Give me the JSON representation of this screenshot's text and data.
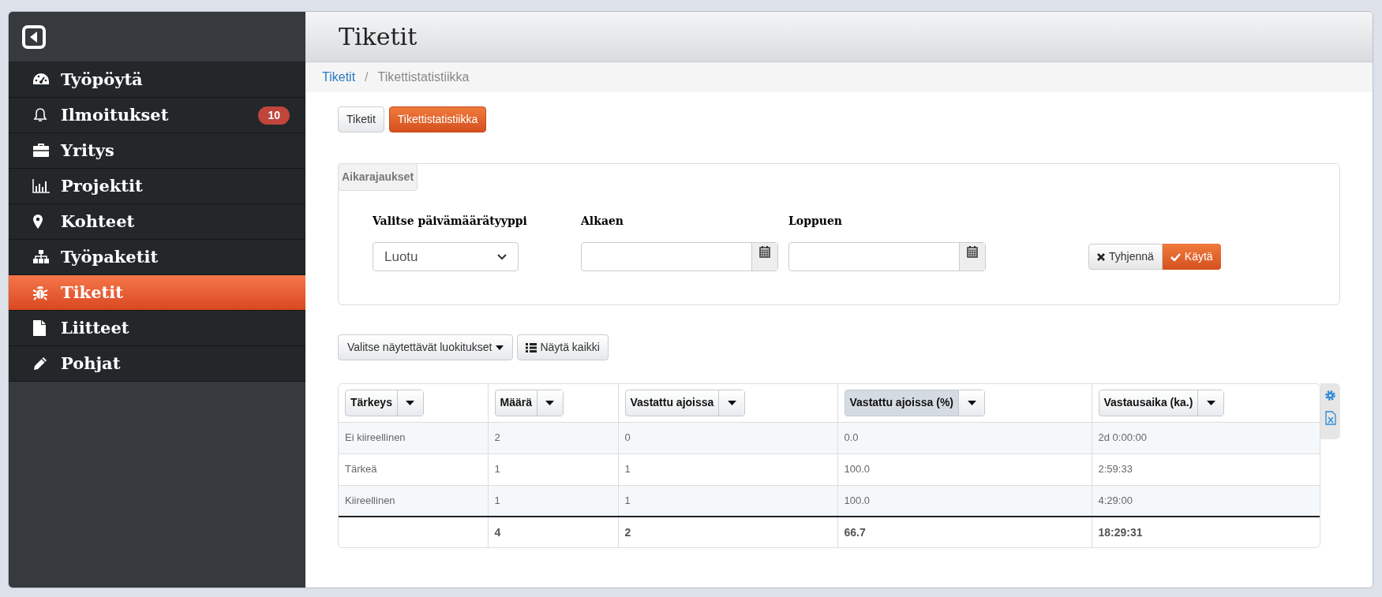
{
  "sidebar": {
    "items": [
      {
        "kind": "dashboard",
        "label": "Työpöytä",
        "selected": false
      },
      {
        "kind": "bell",
        "label": "Ilmoitukset",
        "selected": false,
        "badge": "10"
      },
      {
        "kind": "briefcase",
        "label": "Yritys",
        "selected": false
      },
      {
        "kind": "chart",
        "label": "Projektit",
        "selected": false
      },
      {
        "kind": "pin",
        "label": "Kohteet",
        "selected": false
      },
      {
        "kind": "sitemap",
        "label": "Työpaketit",
        "selected": false
      },
      {
        "kind": "bug",
        "label": "Tiketit",
        "selected": true
      },
      {
        "kind": "file",
        "label": "Liitteet",
        "selected": false
      },
      {
        "kind": "pencil",
        "label": "Pohjat",
        "selected": false
      }
    ]
  },
  "header": {
    "title": "Tiketit"
  },
  "breadcrumb": [
    {
      "label": "Tiketit",
      "link": true
    },
    {
      "separator": "/",
      "label": "Tikettistatistiikka",
      "link": false
    }
  ],
  "tabs": [
    {
      "label": "Tiketit",
      "selected": false
    },
    {
      "label": "Tikettistatistiikka",
      "selected": true
    }
  ],
  "filter": {
    "legend": "Aikarajaukset",
    "date_type": {
      "label": "Valitse päivämäärätyyppi",
      "value": "Luotu"
    },
    "start": {
      "label": "Alkaen"
    },
    "end": {
      "label": "Loppuen"
    },
    "clear": "Tyhjennä",
    "apply": "Käytä"
  },
  "toolbar": {
    "categories": "Valitse näytettävät luokitukset",
    "show_all": "Näytä kaikki"
  },
  "table": {
    "columns": [
      {
        "label": "Tärkeys",
        "selected": false
      },
      {
        "label": "Määrä",
        "selected": false
      },
      {
        "label": "Vastattu ajoissa",
        "selected": false
      },
      {
        "label": "Vastattu ajoissa (%)",
        "selected": true
      },
      {
        "label": "Vastausaika (ka.)",
        "selected": false
      }
    ],
    "rows": [
      [
        "Ei kiireellinen",
        "2",
        "0",
        "0.0",
        "2d 0:00:00"
      ],
      [
        "Tärkeä",
        "1",
        "1",
        "100.0",
        "2:59:33"
      ],
      [
        "Kiireellinen",
        "1",
        "1",
        "100.0",
        "4:29:00"
      ]
    ],
    "totals": [
      "4",
      "2",
      "66.7",
      "18:29:31"
    ]
  }
}
